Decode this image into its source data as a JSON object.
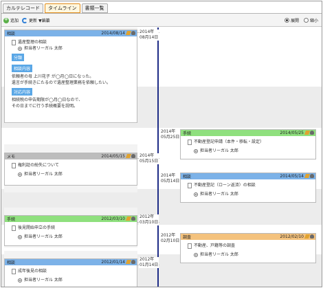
{
  "tabs": [
    {
      "label": "カルテレコード",
      "active": false
    },
    {
      "label": "タイムライン",
      "active": true
    },
    {
      "label": "書類一覧",
      "active": false
    }
  ],
  "toolbar": {
    "add_label": "追加",
    "refresh_label": "更新",
    "edit_label": "▼編纂",
    "expand_label": "展開",
    "collapse_label": "縮小"
  },
  "timeline": {
    "left": [
      {
        "category": "相談",
        "date": "2014/08/14",
        "header_color": "#7cb2e8",
        "title": "遺産整理の相談",
        "person": "担当者リーガル 太郎",
        "sections": [
          {
            "label": "分類",
            "lines": []
          },
          {
            "label": "相談内容",
            "lines": [
              "依頼者の母 上川花子 が◯月◯日になった。",
              "遺言が手続きにたるので遺産整理業務を依頼したい。"
            ]
          },
          {
            "label": "対応内容",
            "lines": [
              "相続税の申告期限が◯月◯日なので、",
              "その日までに行う手続概要を説明。"
            ]
          }
        ]
      },
      {
        "category": "メモ",
        "date": "2014/05/15",
        "header_color": "#bdbdbd",
        "title": "権利証の紛失について",
        "person": "担当者リーガル 太郎"
      },
      {
        "category": "手続",
        "date": "2012/03/10",
        "header_color": "#8fe07e",
        "title": "後見開始申立の手続",
        "person": "担当者リーガル 太郎"
      },
      {
        "category": "相談",
        "date": "2012/01/14",
        "header_color": "#7cb2e8",
        "title": "成年後見の相談",
        "person": "担当者リーガル 太郎"
      }
    ],
    "right": [
      {
        "category": "手続",
        "date": "2014/05/25",
        "header_color": "#8fe07e",
        "title": "不動産登記申請（本件・移転・設定）",
        "person": "担当者リーガル 太郎"
      },
      {
        "category": "相談",
        "date": "2014/05/14",
        "header_color": "#7cb2e8",
        "title": "不動産登記（ローン返済）の相談",
        "person": "担当者リーガル 太郎"
      },
      {
        "category": "調査",
        "date": "2012/02/10",
        "header_color": "#f4c27d",
        "title": "不動産、戸籍等の調査",
        "person": "担当者リーガル 太郎"
      }
    ],
    "date_labels": [
      {
        "year": "2014年",
        "day": "08月14日"
      },
      {
        "year": "2014年",
        "day": "05月25日"
      },
      {
        "year": "2014年",
        "day": "05月15日"
      },
      {
        "year": "2014年",
        "day": "05月14日"
      },
      {
        "year": "2012年",
        "day": "03月10日"
      },
      {
        "year": "2012年",
        "day": "02月10日"
      },
      {
        "year": "2012年",
        "day": "01月14日"
      }
    ]
  }
}
